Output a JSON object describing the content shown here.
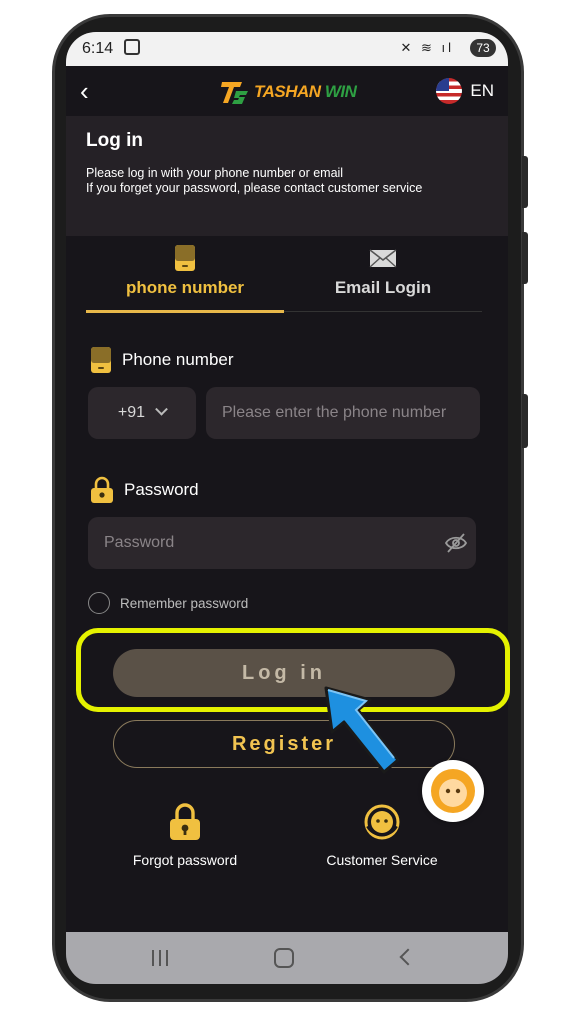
{
  "status_bar": {
    "time": "6:14",
    "battery": "73"
  },
  "header": {
    "brand_left": "TASHAN",
    "brand_right": "WIN",
    "language": "EN"
  },
  "banner": {
    "title": "Log in",
    "line1": "Please log in with your phone number or email",
    "line2": "If you forget your password, please contact customer service"
  },
  "tabs": [
    {
      "label": "phone number",
      "icon": "phone-icon",
      "active": true
    },
    {
      "label": "Email Login",
      "icon": "envelope-icon",
      "active": false
    }
  ],
  "form": {
    "phone_label": "Phone number",
    "country_code": "+91",
    "phone_placeholder": "Please enter the phone number",
    "password_label": "Password",
    "password_placeholder": "Password",
    "remember_label": "Remember password"
  },
  "buttons": {
    "login": "Log in",
    "register": "Register"
  },
  "footer": {
    "forgot": "Forgot password",
    "service": "Customer Service"
  },
  "colors": {
    "accent": "#f0c040",
    "highlight": "#e5f200",
    "arrow": "#1e90e0",
    "background": "#17151a"
  }
}
